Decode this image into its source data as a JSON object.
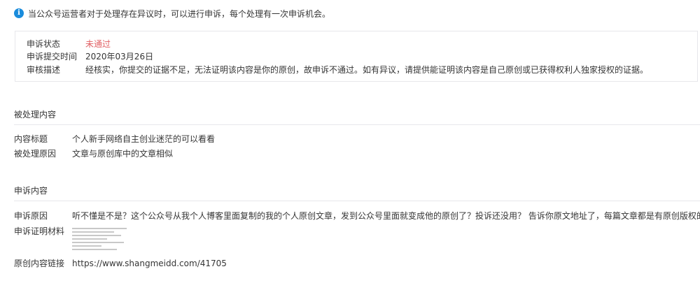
{
  "notice": {
    "icon": "info-icon",
    "text": "当公众号运营者对于处理存在异议时，可以进行申诉，每个处理有一次申诉机会。"
  },
  "status": {
    "state_label": "申诉状态",
    "state_value": "未通过",
    "state_color": "#e15f63",
    "time_label": "申诉提交时间",
    "time_value": "2020年03月26日",
    "desc_label": "审核描述",
    "desc_value": "经核实，你提交的证据不足，无法证明该内容是你的原创，故申诉不通过。如有异议，请提供能证明该内容是自己原创或已获得权利人独家授权的证据。"
  },
  "processed": {
    "section_title": "被处理内容",
    "title_label": "内容标题",
    "title_value": "个人新手网络自主创业迷茫的可以看看",
    "reason_label": "被处理原因",
    "reason_value": "文章与原创库中的文章相似"
  },
  "appeal": {
    "section_title": "申诉内容",
    "reason_label": "申诉原因",
    "reason_value": "听不懂是不是？这个公众号从我个人博客里面复制的我的个人原创文章，发到公众号里面就变成他的原创了？投诉还没用？ 告诉你原文地址了，每篇文章都是有原创版权的",
    "evidence_label": "申诉证明材料",
    "link_label": "原创内容链接",
    "link_value": "https://www.shangmeidd.com/41705"
  },
  "colors": {
    "info_blue": "#1a8cdc",
    "fail_red": "#e15f63",
    "border": "#e7e7eb"
  }
}
